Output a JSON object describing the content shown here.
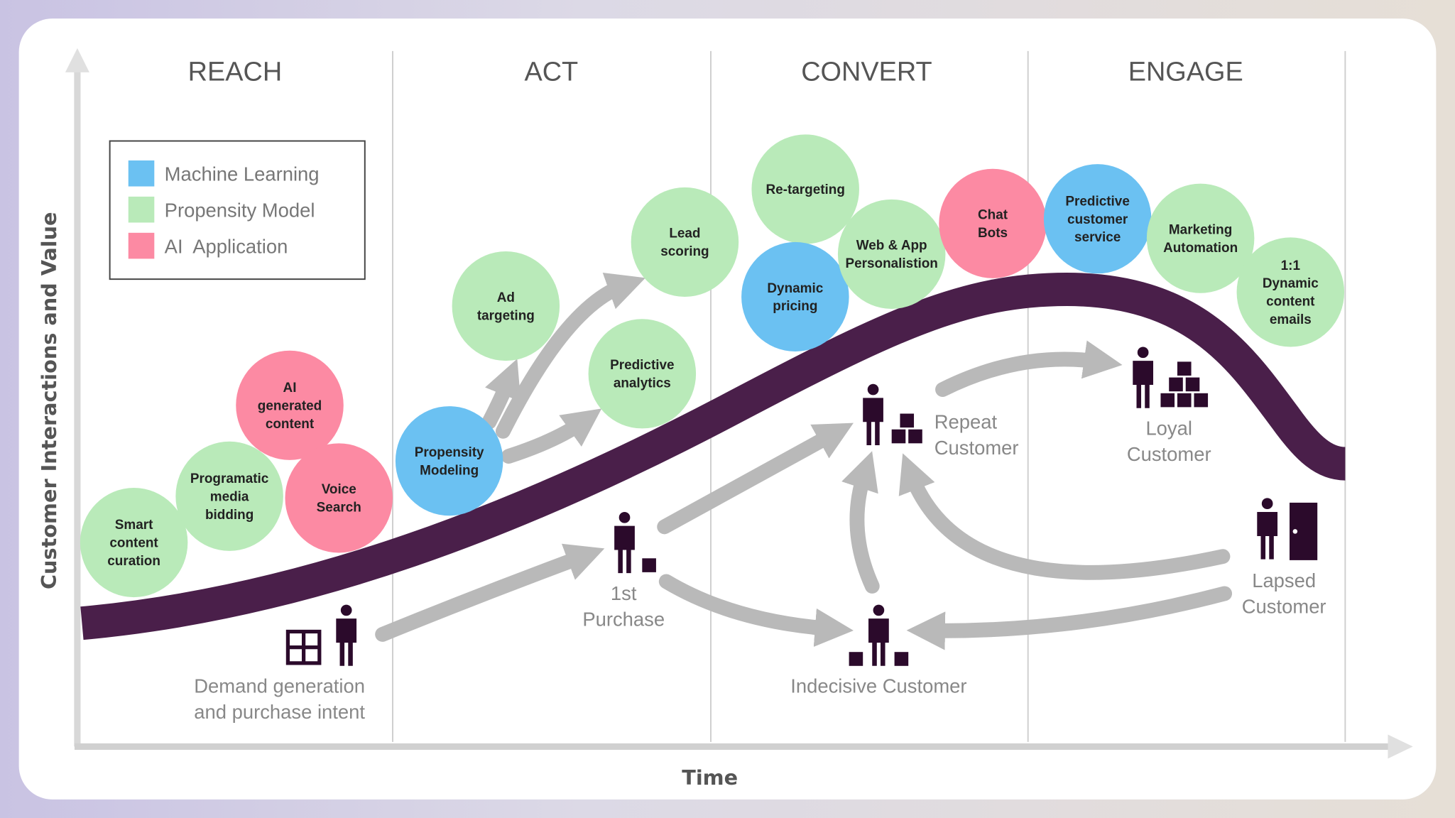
{
  "headers": [
    "REACH",
    "ACT",
    "CONVERT",
    "ENGAGE"
  ],
  "legend": [
    {
      "label": "Machine Learning",
      "category": "ml"
    },
    {
      "label": "Propensity Model",
      "category": "pm"
    },
    {
      "label": "AI  Application",
      "category": "ai"
    }
  ],
  "colors": {
    "ml": "#6bc1f2",
    "pm": "#b9eab9",
    "ai": "#fc8aa3",
    "curve": "#4a1f4a",
    "arrow": "#b9b9b9",
    "icon": "#2b0a2b"
  },
  "axes": {
    "y_label": "Customer Interactions and Value",
    "x_label": "Time"
  },
  "bubbles": [
    {
      "lines": [
        "Smart",
        "content",
        "curation"
      ],
      "category": "pm"
    },
    {
      "lines": [
        "Programatic",
        "media",
        "bidding"
      ],
      "category": "pm"
    },
    {
      "lines": [
        "AI",
        "generated",
        "content"
      ],
      "category": "ai"
    },
    {
      "lines": [
        "Voice",
        "Search"
      ],
      "category": "ai"
    },
    {
      "lines": [
        "Propensity",
        "Modeling"
      ],
      "category": "ml"
    },
    {
      "lines": [
        "Ad",
        "targeting"
      ],
      "category": "pm"
    },
    {
      "lines": [
        "Lead",
        "scoring"
      ],
      "category": "pm"
    },
    {
      "lines": [
        "Predictive",
        "analytics"
      ],
      "category": "pm"
    },
    {
      "lines": [
        "Re-targeting"
      ],
      "category": "pm"
    },
    {
      "lines": [
        "Dynamic",
        "pricing"
      ],
      "category": "ml"
    },
    {
      "lines": [
        "Web & App",
        "Personalistion"
      ],
      "category": "pm"
    },
    {
      "lines": [
        "Chat",
        "Bots"
      ],
      "category": "ai"
    },
    {
      "lines": [
        "Predictive",
        "customer",
        "service"
      ],
      "category": "ml"
    },
    {
      "lines": [
        "Marketing",
        "Automation"
      ],
      "category": "pm"
    },
    {
      "lines": [
        "1:1",
        "Dynamic",
        "content",
        "emails"
      ],
      "category": "pm"
    }
  ],
  "stages": [
    {
      "lines": [
        "Demand generation",
        "and purchase intent"
      ]
    },
    {
      "lines": [
        "1st",
        "Purchase"
      ]
    },
    {
      "lines": [
        "Repeat",
        "Customer"
      ]
    },
    {
      "lines": [
        "Loyal",
        "Customer"
      ]
    },
    {
      "lines": [
        "Indecisive Customer"
      ]
    },
    {
      "lines": [
        "Lapsed",
        "Customer"
      ]
    }
  ]
}
